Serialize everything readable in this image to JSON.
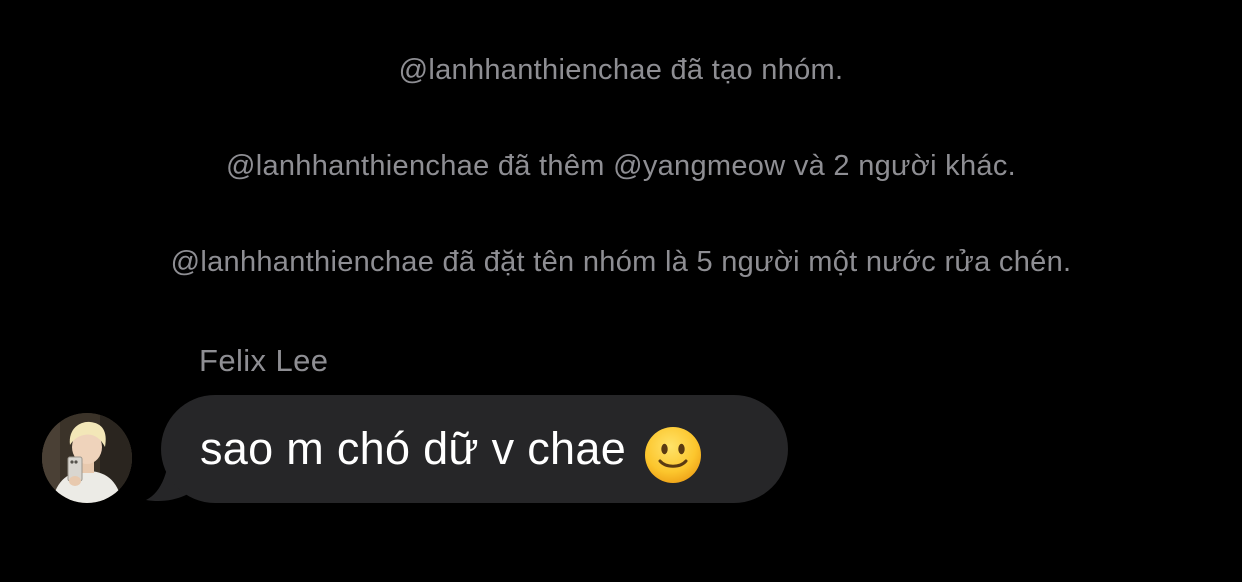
{
  "system_messages": [
    "@lanhhanthienchae đã tạo nhóm.",
    "@lanhhanthienchae đã thêm @yangmeow và 2 người khác.",
    "@lanhhanthienchae đã đặt tên nhóm là 5 người một nước rửa chén."
  ],
  "message": {
    "sender": "Felix Lee",
    "text": "sao m chó dữ v chae",
    "emoji": "slightly-smiling-face-emoji",
    "bubble_color": "#262628"
  },
  "colors": {
    "background": "#000000",
    "system_text": "#8e8e93",
    "message_text": "#ffffff"
  }
}
